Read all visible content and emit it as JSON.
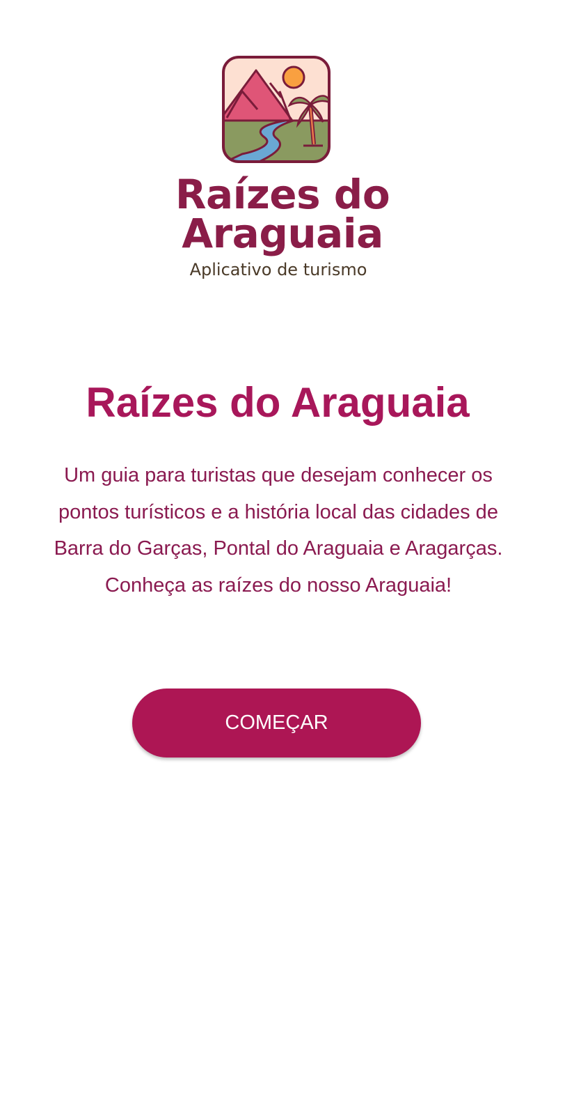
{
  "logo": {
    "text_line1": "Raízes do",
    "text_line2": "Araguaia",
    "subtitle": "Aplicativo de turismo",
    "icon": "landscape-mountains-sun-palm-river-icon"
  },
  "main": {
    "title": "Raízes do Araguaia",
    "description": "Um guia para turistas que desejam conhecer os pontos turísticos e a história local das cidades de Barra do Garças, Pontal do Araguaia e Aragarças. Conheça as raízes do nosso Araguaia!",
    "start_button": "COMEÇAR"
  },
  "colors": {
    "primary": "#ad1654",
    "title": "#a8175a",
    "logo_text": "#8a1d48"
  }
}
